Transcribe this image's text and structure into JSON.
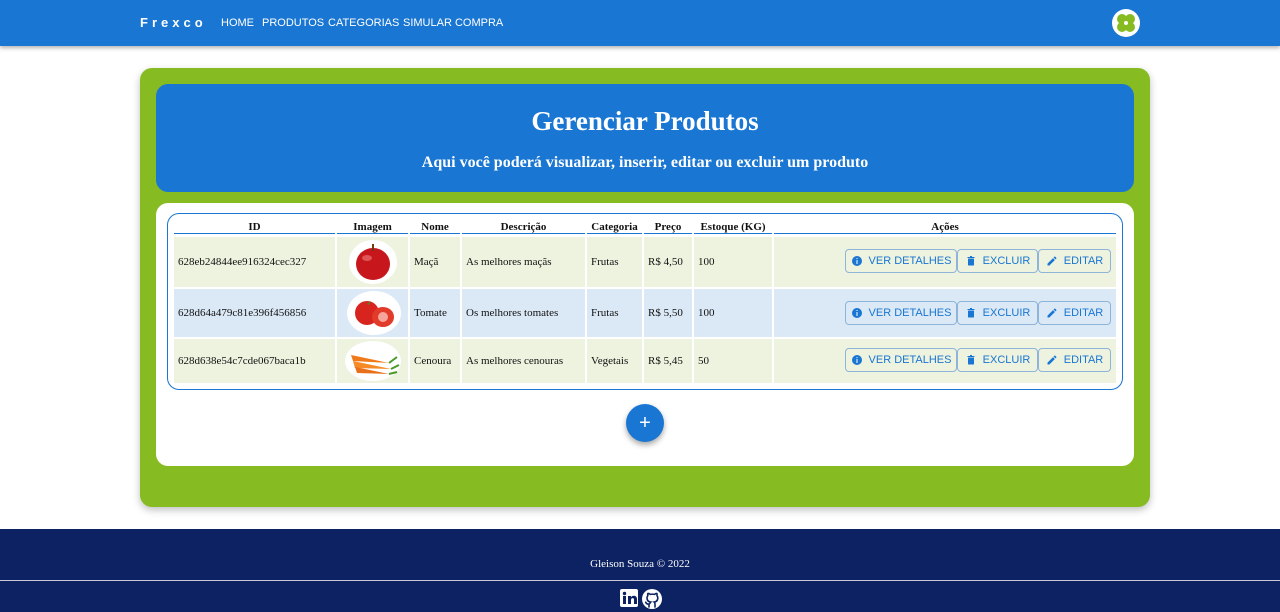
{
  "brand": "Frexco",
  "nav": {
    "items": [
      "HOME",
      "PRODUTOS",
      "CATEGORIAS",
      "SIMULAR COMPRA"
    ]
  },
  "hero": {
    "title": "Gerenciar Produtos",
    "subtitle": "Aqui você poderá visualizar, inserir, editar ou excluir um produto"
  },
  "table": {
    "headers": [
      "ID",
      "Imagem",
      "Nome",
      "Descrição",
      "Categoria",
      "Preço",
      "Estoque (KG)",
      "Ações"
    ],
    "rows": [
      {
        "id": "628eb24844ee916324cec327",
        "image": "apple-image",
        "name": "Maçã",
        "description": "As melhores maçãs",
        "category": "Frutas",
        "price": "R$ 4,50",
        "stock": "100"
      },
      {
        "id": "628d64a479c81e396f456856",
        "image": "tomato-image",
        "name": "Tomate",
        "description": "Os melhores tomates",
        "category": "Frutas",
        "price": "R$ 5,50",
        "stock": "100"
      },
      {
        "id": "628d638e54c7cde067baca1b",
        "image": "carrot-image",
        "name": "Cenoura",
        "description": "As melhores cenouras",
        "category": "Vegetais",
        "price": "R$ 5,45",
        "stock": "50"
      }
    ],
    "actions": {
      "details": "VER DETALHES",
      "delete": "EXCLUIR",
      "edit": "EDITAR"
    }
  },
  "add_button": {
    "label": "+"
  },
  "footer": {
    "text": "Gleison Souza © 2022",
    "social": [
      "linkedin-icon",
      "github-icon"
    ]
  },
  "colors": {
    "primary": "#1976d2",
    "green": "#86bc22",
    "row_green": "#edf3df",
    "row_blue": "#dbe9f7",
    "footer": "#0d2263"
  }
}
